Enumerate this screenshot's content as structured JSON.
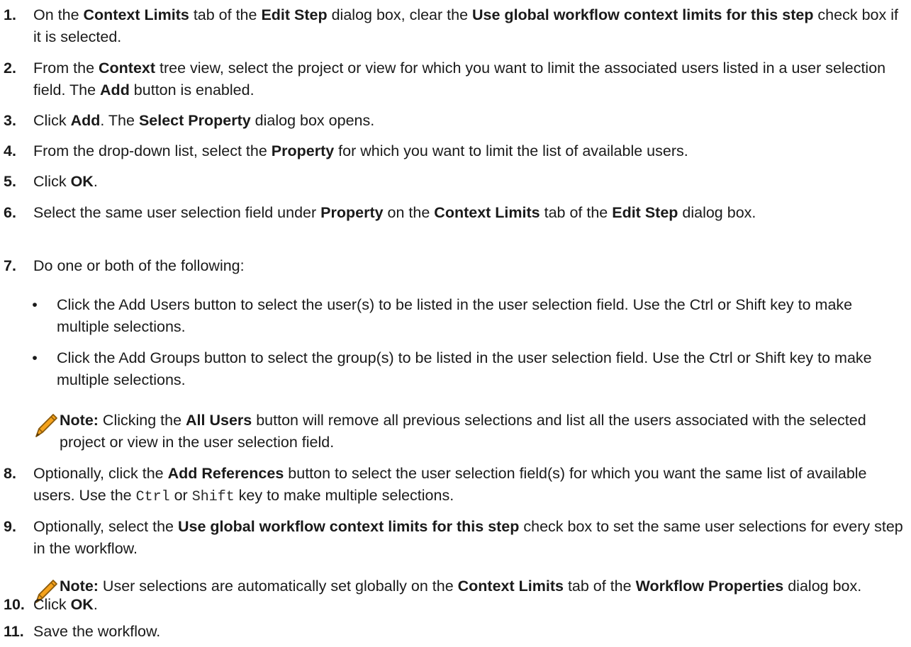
{
  "steps": [
    {
      "num": "1.",
      "t0": "On the ",
      "b1": "Context Limits",
      "t2": " tab of the ",
      "b3": "Edit Step",
      "t4": " dialog box, clear the ",
      "b5": "Use global workflow context limits for this step",
      "t6": " check box if it is selected."
    },
    {
      "num": "2.",
      "t0": "From the ",
      "b1": "Context",
      "t2": " tree view, select the project or view for which you want to limit the associated users listed in a user selection field. The ",
      "b3": "Add",
      "t4": " button is enabled."
    },
    {
      "num": "3.",
      "t0": "Click ",
      "b1": "Add",
      "t2": ". The ",
      "b3": "Select Property",
      "t4": " dialog box opens."
    },
    {
      "num": "4.",
      "t0": "From the drop-down list, select the ",
      "b1": "Property",
      "t2": " for which you want to limit the list of available users."
    },
    {
      "num": "5.",
      "t0": "Click ",
      "b1": "OK",
      "t2": "."
    },
    {
      "num": "6.",
      "t0": "Select the same user selection field under ",
      "b1": "Property",
      "t2": " on the ",
      "b3": "Context Limits",
      "t4": " tab of the ",
      "b5": "Edit Step",
      "t6": " dialog box."
    },
    {
      "num": "7.",
      "t0": "Do one or both of the following:"
    },
    {
      "num": "8.",
      "t0": "Optionally, click the ",
      "b1": "Add References",
      "t2": " button to select the user selection field(s) for which you want the same list of available users. Use the ",
      "m3": "Ctrl",
      "t4": " or ",
      "m5": "Shift",
      "t6": " key to make multiple selections."
    },
    {
      "num": "9.",
      "t0": "Optionally, select the ",
      "b1": "Use global workflow context limits for this step",
      "t2": " check box to set the same user selections for every step in the workflow."
    },
    {
      "num": "10.",
      "t0": "Click ",
      "b1": "OK",
      "t2": "."
    },
    {
      "num": "11.",
      "t0": "Save the workflow."
    }
  ],
  "bullets": [
    {
      "dot": "•",
      "text": "Click the Add Users button to select the user(s) to be listed in the user selection field. Use the Ctrl or Shift key to make multiple selections."
    },
    {
      "dot": "•",
      "text": "Click the Add Groups button to select the group(s) to be listed in the user selection field. Use the Ctrl or Shift key to make multiple selections."
    }
  ],
  "notes": [
    {
      "icon": "pencil-icon",
      "label": "Note:",
      "t0": " Clicking the ",
      "b1": "All Users",
      "t2": " button will remove all previous selections and list all the users associated with the selected project or view in the user selection field."
    },
    {
      "icon": "pencil-icon",
      "label": "Note:",
      "t0": " User selections are automatically set globally on the ",
      "b1": "Context Limits",
      "t2": " tab of the ",
      "b3": "Workflow Properties",
      "t4": " dialog box."
    }
  ],
  "colors": {
    "text": "#1a1a1a",
    "pencil_body": "#f5a21b",
    "pencil_outline": "#8a5a0c"
  }
}
